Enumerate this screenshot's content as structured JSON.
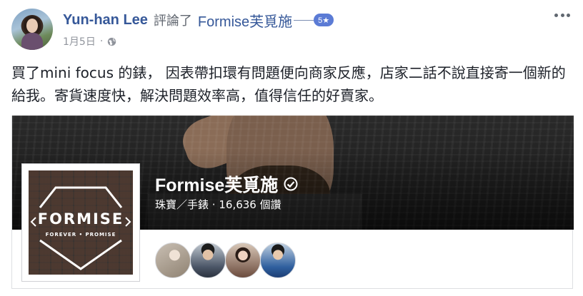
{
  "post": {
    "author": "Yun-han Lee",
    "action_text": "評論了",
    "page_link": "Formise芙覓施",
    "rating": "5★",
    "date": "1月5日",
    "separator": "·",
    "privacy_icon": "globe-icon",
    "more_icon": "more-options-icon",
    "text": "買了mini focus 的錶， 因表帶扣環有問題便向商家反應，店家二話不說直接寄一個新的給我。寄貨速度快，解決問題效率高，值得信任的好賣家。"
  },
  "page_card": {
    "logo_word": "FORMISE",
    "logo_tagline": "FOREVER • PROMISE",
    "name": "Formise芙覓施",
    "verified_icon": "verified-check-icon",
    "category": "珠寶／手錶",
    "likes_separator": "·",
    "likes": "16,636 個讚",
    "friends": [
      "friend-avatar-1",
      "friend-avatar-2",
      "friend-avatar-3",
      "friend-avatar-4"
    ]
  },
  "colors": {
    "link": "#365899",
    "meta": "#90949c",
    "rating_badge": "#5b7bd5",
    "text": "#1d2129"
  }
}
